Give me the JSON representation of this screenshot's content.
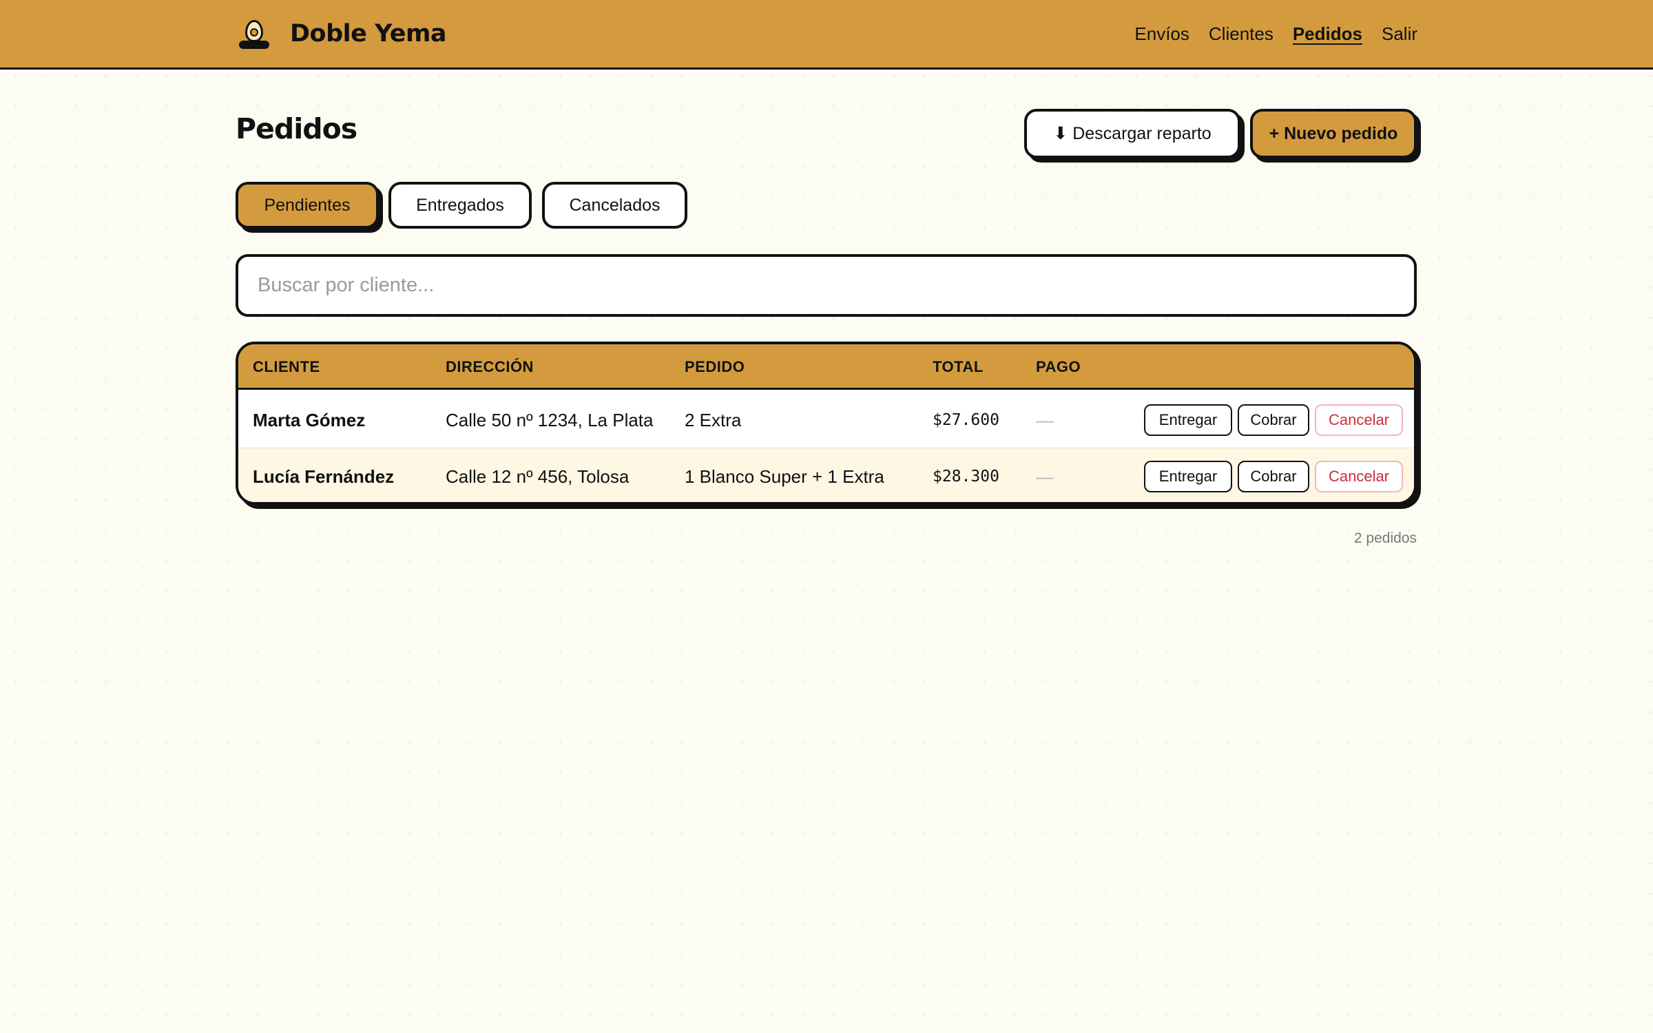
{
  "header": {
    "brand": "Doble Yema",
    "logo_icon": "egg-logo-icon",
    "nav": [
      "Envíos",
      "Clientes",
      "Pedidos",
      "Salir"
    ],
    "active_nav": "Pedidos"
  },
  "page": {
    "title": "Pedidos",
    "download_label": "⬇ Descargar reparto",
    "new_order_label": "+ Nuevo pedido"
  },
  "tabs": [
    "Pendientes",
    "Entregados",
    "Cancelados"
  ],
  "active_tab": "Pendientes",
  "search": {
    "placeholder": "Buscar por cliente...",
    "value": ""
  },
  "table": {
    "headers": [
      "CLIENTE",
      "DIRECCIÓN",
      "PEDIDO",
      "TOTAL",
      "PAGO"
    ],
    "rows": [
      {
        "cliente": "Marta Gómez",
        "direccion": "Calle 50 nº 1234, La Plata",
        "pedido": "2 Extra",
        "total": "$27.600",
        "pago": "—",
        "actions": [
          "Entregar",
          "Cobrar",
          "Cancelar"
        ]
      },
      {
        "cliente": "Lucía Fernández",
        "direccion": "Calle 12 nº 456, Tolosa",
        "pedido": "1 Blanco Super + 1 Extra",
        "total": "$28.300",
        "pago": "—",
        "actions": [
          "Entregar",
          "Cobrar",
          "Cancelar"
        ]
      }
    ]
  },
  "footer": {
    "count": "2 pedidos"
  },
  "colors": {
    "accent": "#d49b3e",
    "background": "#fdfcf3",
    "danger": "#c8303a",
    "ink": "#111111"
  }
}
